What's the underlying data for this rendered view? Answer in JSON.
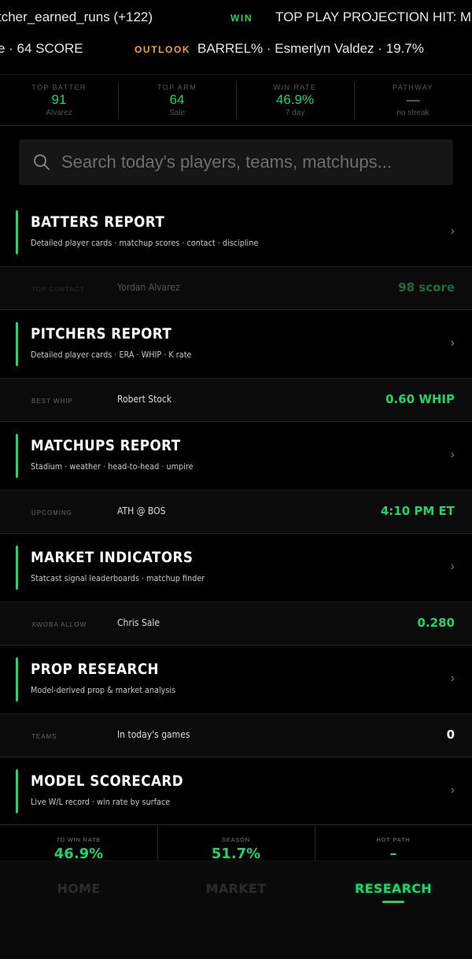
{
  "ticker": {
    "row1": [
      {
        "text": "tcher_earned_runs (+122)",
        "kind": "text"
      },
      {
        "text": "WIN",
        "kind": "win-label"
      },
      {
        "text": "TOP PLAY PROJECTION HIT: M",
        "kind": "text"
      }
    ],
    "row2": [
      {
        "text": "e · 64 SCORE",
        "kind": "text"
      },
      {
        "text": "OUTLOOK",
        "kind": "outlook-label"
      },
      {
        "text": "BARREL% · Esmerlyn Valdez · 19.7%",
        "kind": "text"
      }
    ]
  },
  "stats": [
    {
      "label": "TOP BATTER",
      "value": "91",
      "sub": "Alvarez"
    },
    {
      "label": "TOP ARM",
      "value": "64",
      "sub": "Sale"
    },
    {
      "label": "WIN RATE",
      "value": "46.9%",
      "sub": "7 day"
    },
    {
      "label": "PATHWAY",
      "value": "—",
      "sub": "no streak"
    }
  ],
  "search": {
    "placeholder": "Search today's players, teams, matchups..."
  },
  "reports": [
    {
      "title": "BATTERS REPORT",
      "desc": "Detailed player cards · matchup scores · contact · discipline",
      "highlight": {
        "label": "TOP CONTACT",
        "name": "Yordan Alvarez",
        "value": "98 score"
      }
    },
    {
      "title": "PITCHERS REPORT",
      "desc": "Detailed player cards · ERA · WHIP · K rate",
      "highlight": {
        "label": "BEST WHIP",
        "name": "Robert Stock",
        "value": "0.60 WHIP"
      }
    },
    {
      "title": "MATCHUPS REPORT",
      "desc": "Stadium · weather · head-to-head · umpire",
      "highlight": {
        "label": "UPCOMING",
        "name": "ATH @ BOS",
        "value": "4:10 PM ET"
      }
    },
    {
      "title": "MARKET INDICATORS",
      "desc": "Statcast signal leaderboards · matchup finder",
      "highlight": {
        "label": "XWOBA ALLOW",
        "name": "Chris Sale",
        "value": "0.280"
      }
    },
    {
      "title": "PROP RESEARCH",
      "desc": "Model-derived prop & market analysis",
      "highlight": {
        "label": "TEAMS",
        "name": "In today's games",
        "value": "0"
      }
    },
    {
      "title": "MODEL SCORECARD",
      "desc": "Live W/L record · win rate by surface"
    }
  ],
  "chevron": "›",
  "scorecard": [
    {
      "label": "7D WIN RATE",
      "value": "46.9%"
    },
    {
      "label": "SEASON",
      "value": "51.7%"
    },
    {
      "label": "HOT PATH",
      "value": "–"
    }
  ],
  "nav": [
    {
      "label": "HOME",
      "active": false
    },
    {
      "label": "MARKET",
      "active": false
    },
    {
      "label": "RESEARCH",
      "active": true
    }
  ],
  "colors": {
    "accent": "#22d36b",
    "outlook": "#f0a035",
    "background": "#000000"
  }
}
